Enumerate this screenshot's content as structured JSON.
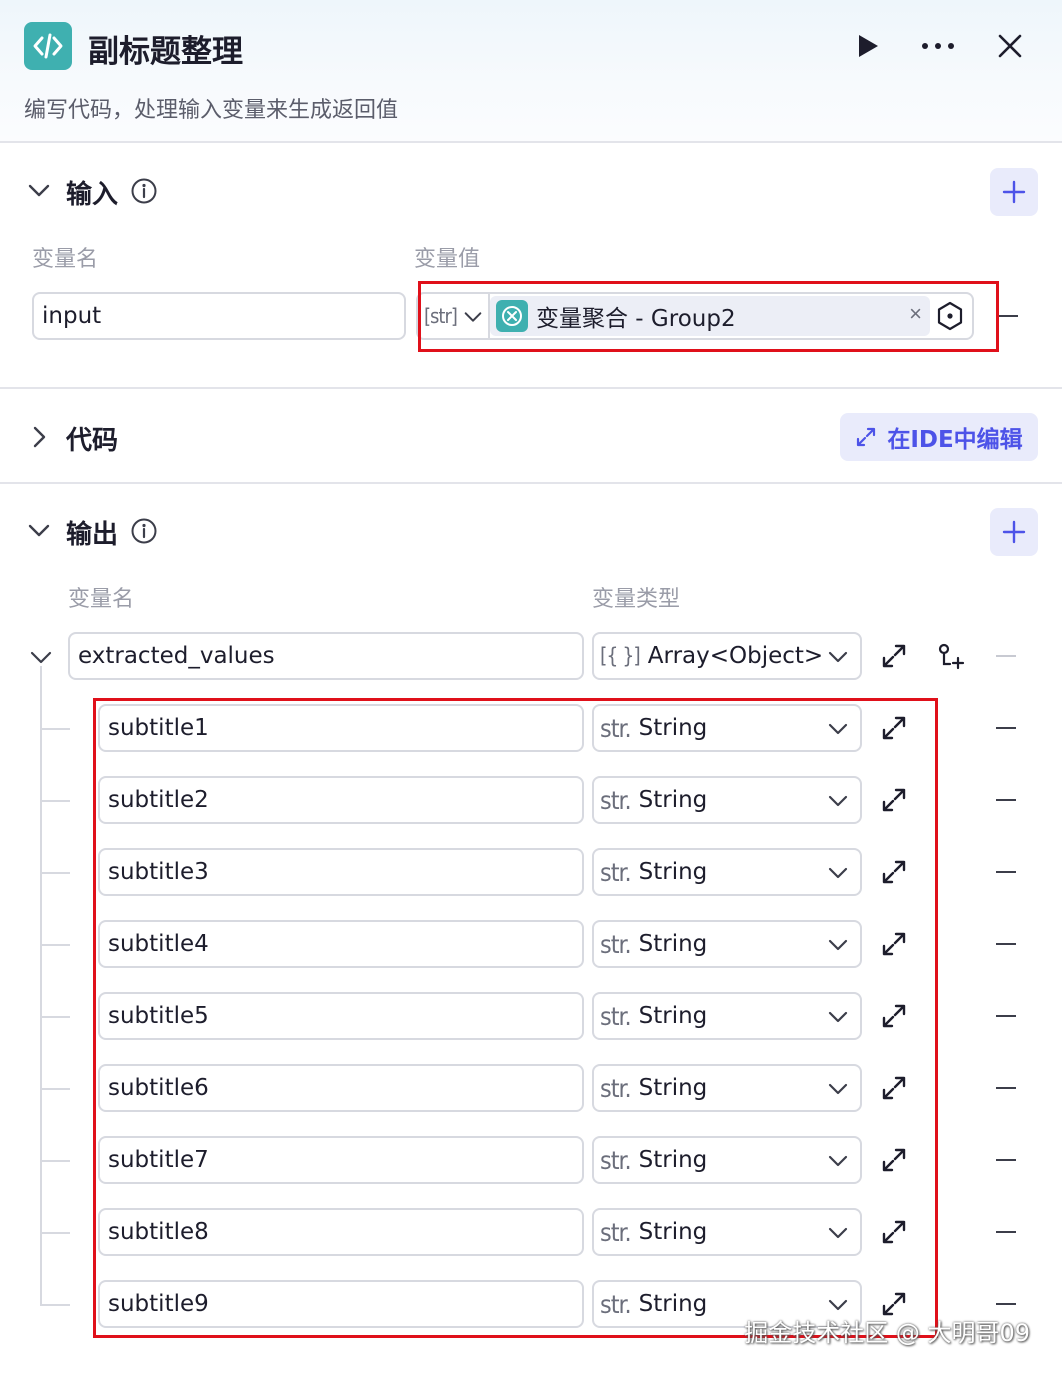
{
  "node": {
    "title": "副标题整理",
    "description": "编写代码，处理输入变量来生成返回值",
    "icon": "code-icon",
    "actions": [
      "play-icon",
      "more-icon",
      "close-icon"
    ]
  },
  "input_section": {
    "title": "输入",
    "col_name": "变量名",
    "col_value": "变量值",
    "rows": [
      {
        "name": "input",
        "type_prefix": "[str]",
        "value_label": "变量聚合 - Group2",
        "clear_symbol": "×"
      }
    ]
  },
  "code_section": {
    "title": "代码",
    "ide_button": "在IDE中编辑"
  },
  "output_section": {
    "title": "输出",
    "col_name": "变量名",
    "col_type": "变量类型",
    "root": {
      "name": "extracted_values",
      "type_prefix": "[{ }]",
      "type": "Array<Object>"
    },
    "children": [
      {
        "name": "subtitle1",
        "type_prefix": "str.",
        "type": "String"
      },
      {
        "name": "subtitle2",
        "type_prefix": "str.",
        "type": "String"
      },
      {
        "name": "subtitle3",
        "type_prefix": "str.",
        "type": "String"
      },
      {
        "name": "subtitle4",
        "type_prefix": "str.",
        "type": "String"
      },
      {
        "name": "subtitle5",
        "type_prefix": "str.",
        "type": "String"
      },
      {
        "name": "subtitle6",
        "type_prefix": "str.",
        "type": "String"
      },
      {
        "name": "subtitle7",
        "type_prefix": "str.",
        "type": "String"
      },
      {
        "name": "subtitle8",
        "type_prefix": "str.",
        "type": "String"
      },
      {
        "name": "subtitle9",
        "type_prefix": "str.",
        "type": "String"
      }
    ]
  },
  "watermark": "掘金技术社区 @ 大明哥09",
  "colors": {
    "accent": "#4d53e8",
    "teal": "#3fb0b0",
    "highlight": "#e0101a"
  }
}
